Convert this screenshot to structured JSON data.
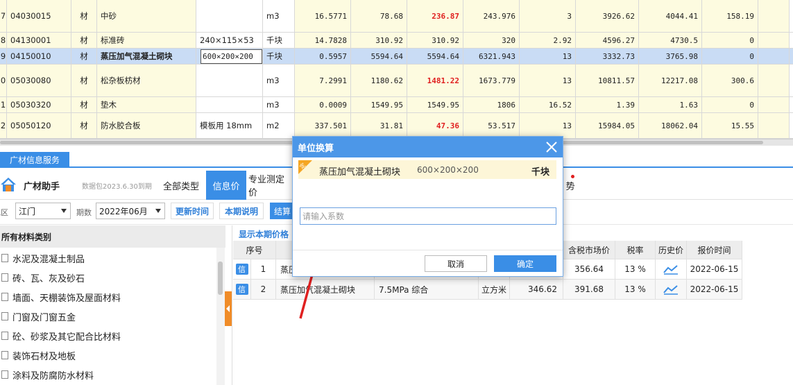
{
  "grid": {
    "rows": [
      {
        "idx": "7",
        "code": "04030015",
        "type": "材",
        "name": "中砂",
        "spec": "",
        "unit": "m3",
        "qty": "16.5771",
        "price1": "78.68",
        "price2": "236.87",
        "price3": "243.976",
        "rate": "3",
        "amt1": "3926.62",
        "amt2": "4044.41",
        "diff": "158.19",
        "price2_red": true
      },
      {
        "idx": "8",
        "code": "04130001",
        "type": "材",
        "name": "标准砖",
        "spec": "240×115×53",
        "unit": "千块",
        "qty": "14.7828",
        "price1": "310.92",
        "price2": "310.92",
        "price3": "320",
        "rate": "2.92",
        "amt1": "4596.27",
        "amt2": "4730.5",
        "diff": "0",
        "price2_red": false
      },
      {
        "idx": "9",
        "code": "04150010",
        "type": "材",
        "name": "蒸压加气混凝土砌块",
        "spec": "600×200×200",
        "unit": "千块",
        "qty": "0.5957",
        "price1": "5594.64",
        "price2": "5594.64",
        "price3": "6321.943",
        "rate": "13",
        "amt1": "3332.73",
        "amt2": "3765.98",
        "diff": "0",
        "price2_red": false
      },
      {
        "idx": "0",
        "code": "05030080",
        "type": "材",
        "name": "松杂板枋材",
        "spec": "",
        "unit": "m3",
        "qty": "7.2991",
        "price1": "1180.62",
        "price2": "1481.22",
        "price3": "1673.779",
        "rate": "13",
        "amt1": "10811.57",
        "amt2": "12217.08",
        "diff": "300.6",
        "price2_red": true
      },
      {
        "idx": "1",
        "code": "05030320",
        "type": "材",
        "name": "垫木",
        "spec": "",
        "unit": "m3",
        "qty": "0.0009",
        "price1": "1549.95",
        "price2": "1549.95",
        "price3": "1806",
        "rate": "16.52",
        "amt1": "1.39",
        "amt2": "1.63",
        "diff": "0",
        "price2_red": false
      },
      {
        "idx": "2",
        "code": "05050120",
        "type": "材",
        "name": "防水胶合板",
        "spec": "模板用 18mm",
        "unit": "m2",
        "qty": "337.501",
        "price1": "31.81",
        "price2": "47.36",
        "price3": "53.517",
        "rate": "13",
        "amt1": "15984.05",
        "amt2": "18062.04",
        "diff": "15.55",
        "price2_red": true
      }
    ]
  },
  "service_tab": "广材信息服务",
  "app": {
    "name": "广材助手",
    "package_info": "数据包2023.6.30到期"
  },
  "nav_tabs": [
    "全部类型",
    "信息价",
    "专业测定价",
    "势"
  ],
  "filters": {
    "region_label": "地区",
    "region_value": "江门",
    "period_label": "期数",
    "period_value": "2022年06月",
    "update_time_btn": "更新时间",
    "period_desc_btn": "本期说明",
    "settle_btn": "结算"
  },
  "categories": {
    "header": "所有材料类别",
    "items": [
      "水泥及混凝土制品",
      "砖、瓦、灰及砂石",
      "墙面、天棚装饰及屋面材料",
      "门窗及门窗五金",
      "砼、砂浆及其它配合比材料",
      "装饰石材及地板",
      "涂料及防腐防水材料"
    ]
  },
  "results": {
    "show_current_price": "显示本期价格",
    "headers": {
      "seq": "序号",
      "tax_price": "含税市场价",
      "tax_rate": "税率",
      "history": "历史价",
      "report_time": "报价时间"
    },
    "rows": [
      {
        "badge": "信",
        "seq": "1",
        "name": "蒸压",
        "spec": "",
        "unit": "",
        "price": "",
        "tax_price": "356.64",
        "tax_rate": "13 %",
        "report_time": "2022-06-15"
      },
      {
        "badge": "信",
        "seq": "2",
        "name": "蒸压加气混凝土砌块",
        "spec": "7.5MPa 综合",
        "unit": "立方米",
        "price": "346.62",
        "tax_price": "391.68",
        "tax_rate": "13 %",
        "report_time": "2022-06-15"
      }
    ]
  },
  "modal": {
    "title": "单位换算",
    "ding": "定",
    "material_name": "蒸压加气混凝土砌块",
    "material_spec": "600×200×200",
    "material_unit": "千块",
    "coef_placeholder": "请输入系数",
    "coef_value": "",
    "cancel": "取消",
    "ok": "确定"
  },
  "colors": {
    "accent": "#3a8ee6",
    "annotation_arrow": "#e02020",
    "price_red": "#e02020",
    "highlight_row": "#c9dcf5"
  }
}
